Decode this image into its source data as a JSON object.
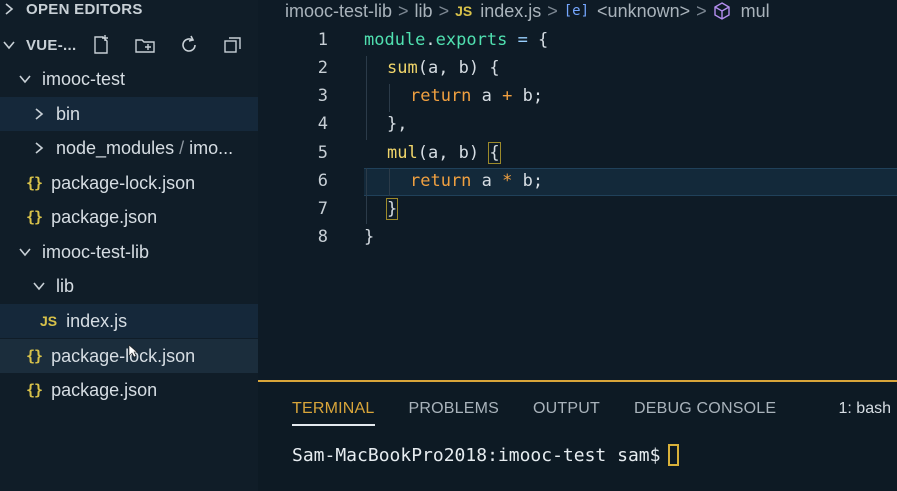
{
  "sidebar": {
    "open_editors_label": "OPEN EDITORS",
    "workspace_label": "VUE-...",
    "tree": {
      "folder1": "imooc-test",
      "bin": "bin",
      "node_modules": "node_modules",
      "node_modules_sep": "/",
      "node_modules_suffix": "imo...",
      "f1_lock": "package-lock.json",
      "f1_pkg": "package.json",
      "folder2": "imooc-test-lib",
      "lib": "lib",
      "index": "index.js",
      "f2_lock": "package-lock.json",
      "f2_pkg": "package.json"
    },
    "json_icon": "{}",
    "js_icon": "JS"
  },
  "breadcrumb": {
    "folder": "imooc-test-lib",
    "sub": "lib",
    "js_icon": "JS",
    "file": "index.js",
    "var_icon": "[e]",
    "symbol1": "<unknown>",
    "symbol2": "mul",
    "separator": ">"
  },
  "editor": {
    "line_numbers": [
      "1",
      "2",
      "3",
      "4",
      "5",
      "6",
      "7",
      "8"
    ],
    "tokens": {
      "l1_a": "module",
      "l1_b": ".",
      "l1_c": "exports",
      "l1_d": " = ",
      "l1_e": "{",
      "l2_a": "sum",
      "l2_b": "(a, b) {",
      "l3_a": "return",
      "l3_b": " a ",
      "l3_c": "+",
      "l3_d": " b;",
      "l4": "},",
      "l5_a": "mul",
      "l5_b": "(a, b) ",
      "l5_c": "{",
      "l6_a": "return",
      "l6_b": " a ",
      "l6_c": "*",
      "l6_d": " b;",
      "l7": "}",
      "l8": "}"
    }
  },
  "panel": {
    "tabs": [
      "TERMINAL",
      "PROBLEMS",
      "OUTPUT",
      "DEBUG CONSOLE"
    ],
    "active_tab": "TERMINAL",
    "shell": "1: bash",
    "prompt": "Sam-MacBookPro2018:imooc-test sam$"
  },
  "colors": {
    "accent": "#d8a53a",
    "json_icon": "#d8c24a",
    "keyword": "#f0a040",
    "function": "#f0d56a",
    "module": "#50e0b0"
  }
}
